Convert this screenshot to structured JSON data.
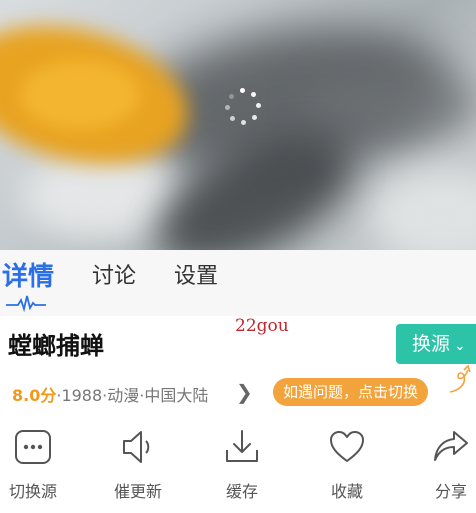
{
  "player": {
    "loading": true
  },
  "tabs": [
    {
      "label": "详情",
      "active": true
    },
    {
      "label": "讨论",
      "active": false
    },
    {
      "label": "设置",
      "active": false
    }
  ],
  "title": "螳螂捕蝉",
  "watermark": "22gou",
  "switch_source": {
    "label": "换源"
  },
  "meta": {
    "score": "8.0分",
    "info": "·1988·动漫·中国大陆"
  },
  "tip": "如遇问题，点击切换",
  "actions": [
    {
      "label": "切换源",
      "icon": "more-dots-icon"
    },
    {
      "label": "催更新",
      "icon": "speaker-icon"
    },
    {
      "label": "缓存",
      "icon": "download-icon"
    },
    {
      "label": "收藏",
      "icon": "heart-icon"
    },
    {
      "label": "分享",
      "icon": "share-icon"
    }
  ],
  "colors": {
    "accent_blue": "#2b6fe8",
    "switch_green": "#2dc3a8",
    "score_orange": "#f29a18",
    "tip_orange": "#f2a33c",
    "watermark_red": "#c0282e"
  }
}
